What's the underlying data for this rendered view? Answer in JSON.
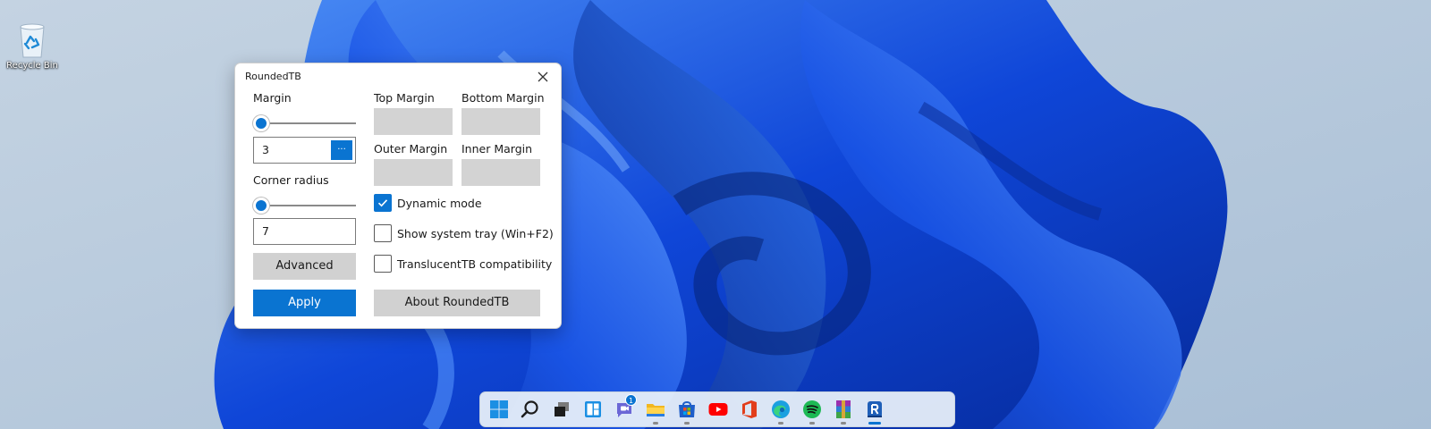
{
  "desktop": {
    "recycle_bin_label": "Recycle Bin"
  },
  "dialog": {
    "title": "RoundedTB",
    "margin_label": "Margin",
    "margin_slider_value": 0,
    "margin_value": "3",
    "more_button_label": "...",
    "corner_radius_label": "Corner radius",
    "corner_radius_slider_value": 0,
    "corner_radius_value": "7",
    "advanced_label": "Advanced",
    "apply_label": "Apply",
    "top_margin_label": "Top Margin",
    "bottom_margin_label": "Bottom Margin",
    "outer_margin_label": "Outer Margin",
    "inner_margin_label": "Inner Margin",
    "dynamic_mode_label": "Dynamic mode",
    "dynamic_mode_checked": true,
    "show_tray_label": "Show system tray (Win+F2)",
    "show_tray_checked": false,
    "translucent_label": "TranslucentTB compatibility",
    "translucent_checked": false,
    "about_label": "About RoundedTB"
  },
  "taskbar": {
    "items": [
      {
        "name": "start",
        "icon": "windows-logo-icon"
      },
      {
        "name": "search",
        "icon": "search-icon"
      },
      {
        "name": "task-view",
        "icon": "task-view-icon"
      },
      {
        "name": "widgets",
        "icon": "widgets-icon"
      },
      {
        "name": "chat",
        "icon": "teams-chat-icon",
        "badge": "1"
      },
      {
        "name": "file-explorer",
        "icon": "folder-icon",
        "running": true
      },
      {
        "name": "store",
        "icon": "store-icon",
        "running": true
      },
      {
        "name": "youtube",
        "icon": "youtube-icon"
      },
      {
        "name": "office",
        "icon": "office-icon"
      },
      {
        "name": "edge",
        "icon": "edge-icon",
        "running": true
      },
      {
        "name": "spotify",
        "icon": "spotify-icon",
        "running": true
      },
      {
        "name": "winrar",
        "icon": "winrar-icon",
        "running": true
      },
      {
        "name": "roundedtb",
        "icon": "roundedtb-icon",
        "active": true
      }
    ]
  },
  "colors": {
    "accent": "#0a74d1",
    "wallpaper_bg": "#b9cadc",
    "bloom": "#0b3fd0"
  }
}
